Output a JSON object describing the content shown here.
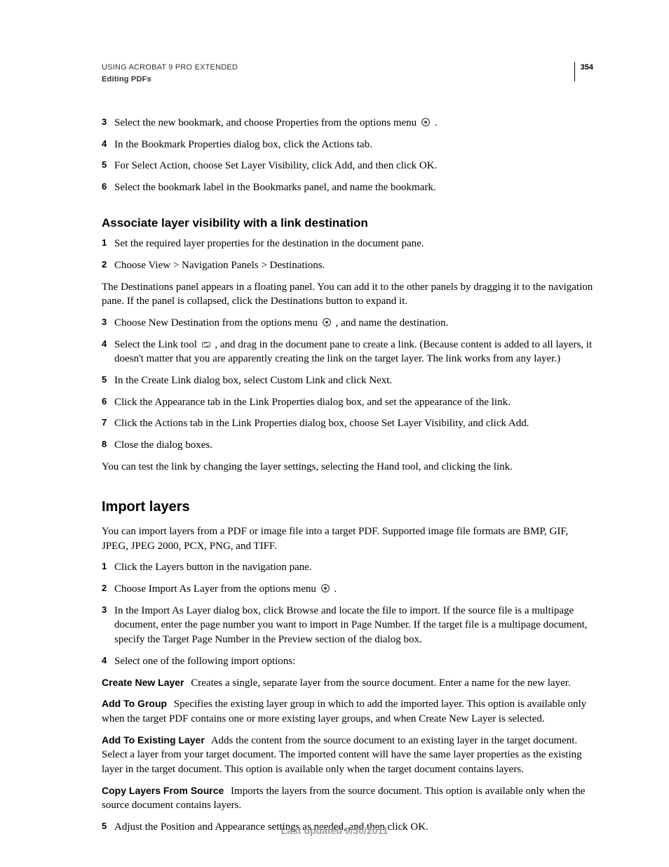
{
  "header": {
    "line1": "USING ACROBAT 9 PRO EXTENDED",
    "line2": "Editing PDFs",
    "page_number": "354"
  },
  "section1": {
    "steps": [
      {
        "text_before": "Select the new bookmark, and choose Properties from the options menu ",
        "text_after": "."
      },
      {
        "text_before": "In the Bookmark Properties dialog box, click the Actions tab."
      },
      {
        "text_before": "For Select Action, choose Set Layer Visibility, click Add, and then click OK."
      },
      {
        "text_before": "Select the bookmark label in the Bookmarks panel, and name the bookmark."
      }
    ]
  },
  "section2": {
    "heading": "Associate layer visibility with a link destination",
    "stepsA": [
      {
        "text_before": "Set the required layer properties for the destination in the document pane."
      },
      {
        "text_before": "Choose View > Navigation Panels > Destinations."
      }
    ],
    "para1": "The Destinations panel appears in a floating panel. You can add it to the other panels by dragging it to the navigation pane. If the panel is collapsed, click the Destinations button to expand it.",
    "stepsB": [
      {
        "text_before": "Choose New Destination from the options menu ",
        "text_after": ", and name the destination."
      },
      {
        "text_before": "Select the Link tool ",
        "text_after": ", and drag in the document pane to create a link. (Because content is added to all layers, it doesn't matter that you are apparently creating the link on the target layer. The link works from any layer.)"
      },
      {
        "text_before": "In the Create Link dialog box, select Custom Link and click Next."
      },
      {
        "text_before": "Click the Appearance tab in the Link Properties dialog box, and set the appearance of the link."
      },
      {
        "text_before": "Click the Actions tab in the Link Properties dialog box, choose Set Layer Visibility, and click Add."
      },
      {
        "text_before": "Close the dialog boxes."
      }
    ],
    "para2": "You can test the link by changing the layer settings, selecting the Hand tool, and clicking the link."
  },
  "section3": {
    "heading": "Import layers",
    "intro": "You can import layers from a PDF or image file into a target PDF. Supported image file formats are BMP, GIF, JPEG, JPEG 2000, PCX, PNG, and TIFF.",
    "stepsA": [
      {
        "text_before": "Click the Layers button in the navigation pane."
      },
      {
        "text_before": "Choose Import As Layer from the options menu ",
        "text_after": "."
      },
      {
        "text_before": "In the Import As Layer dialog box, click Browse and locate the file to import. If the source file is a multipage document, enter the page number you want to import in Page Number. If the target file is a multipage document, specify the Target Page Number in the Preview section of the dialog box."
      },
      {
        "text_before": "Select one of the following import options:"
      }
    ],
    "defs": [
      {
        "term": "Create New Layer",
        "desc": "Creates a single, separate layer from the source document. Enter a name for the new layer."
      },
      {
        "term": "Add To Group",
        "desc": "Specifies the existing layer group in which to add the imported layer. This option is available only when the target PDF contains one or more existing layer groups, and when Create New Layer is selected."
      },
      {
        "term": "Add To Existing Layer",
        "desc": "Adds the content from the source document to an existing layer in the target document. Select a layer from your target document. The imported content will have the same layer properties as the existing layer in the target document. This option is available only when the target document contains layers."
      },
      {
        "term": "Copy Layers From Source",
        "desc": "Imports the layers from the source document. This option is available only when the source document contains layers."
      }
    ],
    "stepsB": [
      {
        "text_before": "Adjust the Position and Appearance settings as needed, and then click OK."
      }
    ]
  },
  "footer": "Last updated 9/30/2011"
}
